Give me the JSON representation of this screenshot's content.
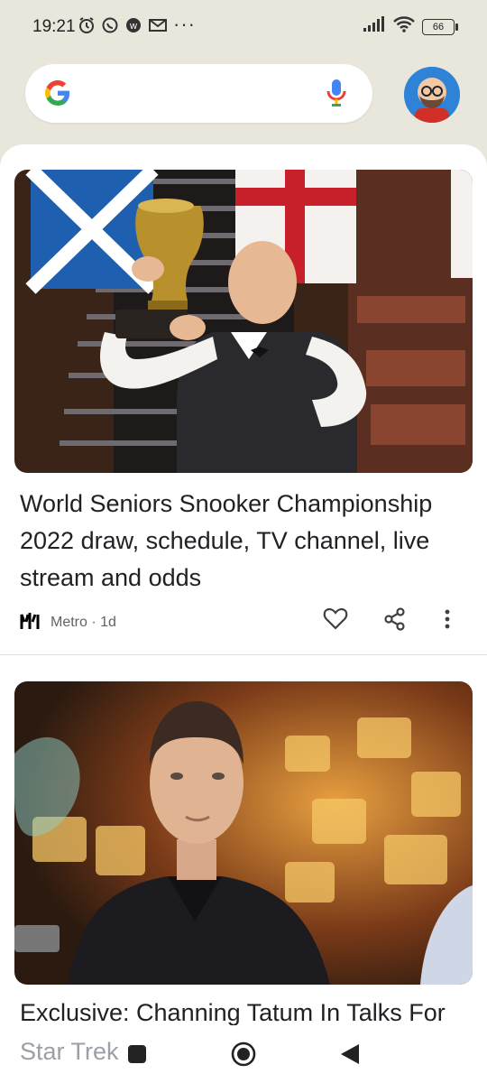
{
  "status_bar": {
    "time": "19:21",
    "overflow": "···",
    "battery": "66",
    "left_icons": [
      "alarm-icon",
      "whatsapp-icon",
      "app-icon",
      "gmail-icon"
    ],
    "right_icons": [
      "signal-icon",
      "wifi-icon",
      "battery-icon"
    ]
  },
  "search": {
    "placeholder": "",
    "logo": "google-logo",
    "mic_icon": "mic-icon",
    "avatar": "profile-avatar"
  },
  "articles": [
    {
      "title": "World Seniors Snooker Championship 2022 draw, schedule, TV channel, live stream and odds",
      "source": "Metro",
      "age": "1d",
      "source_line": "Metro · 1d",
      "image": "snooker-player-trophy",
      "actions": [
        "heart-icon",
        "share-icon",
        "more-vert-icon"
      ]
    },
    {
      "title_visible": "Exclusive: Channing Tatum In Talks For",
      "title_cut": "Star Trek",
      "image": "actor-portrait"
    }
  ],
  "nav_bar": {
    "items": [
      "recents-button",
      "home-button",
      "back-button"
    ]
  },
  "colors": {
    "background": "#e9e6dc",
    "feed": "#ffffff",
    "text": "#202124",
    "secondary": "#5f6368"
  }
}
